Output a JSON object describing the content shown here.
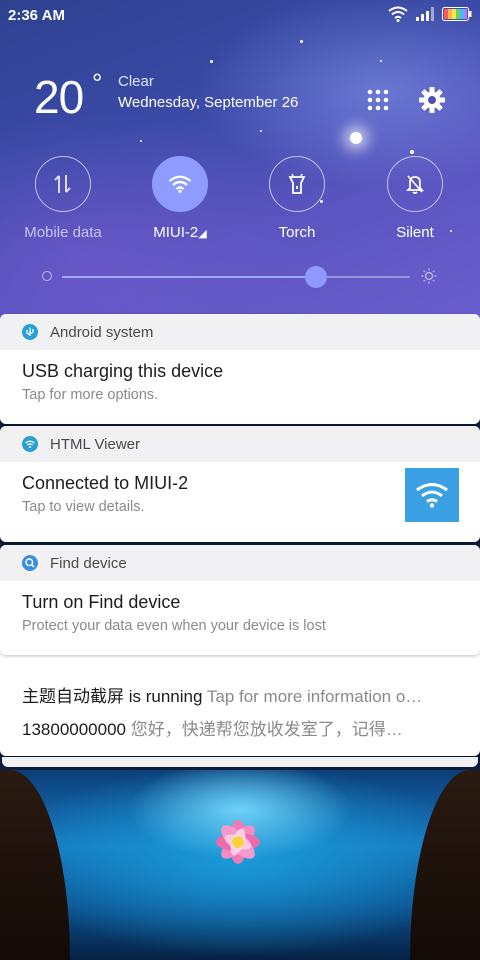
{
  "status_bar": {
    "time": "2:36 AM"
  },
  "header": {
    "temperature": "20",
    "degree": "°",
    "weather": "Clear",
    "date": "Wednesday, September 26"
  },
  "toggles": [
    {
      "label": "Mobile data",
      "state": "off"
    },
    {
      "label": "MIUI-2",
      "state": "on"
    },
    {
      "label": "Torch",
      "state": "off"
    },
    {
      "label": "Silent",
      "state": "off"
    }
  ],
  "brightness": {
    "level": 0.73
  },
  "notifications": [
    {
      "app": "Android system",
      "title": "USB charging this device",
      "text": "Tap for more options."
    },
    {
      "app": "HTML Viewer",
      "title": "Connected to MIUI-2",
      "text": "Tap to view details."
    },
    {
      "app": "Find device",
      "title": "Turn on Find device",
      "text": "Protect your data even when your device is lost"
    }
  ],
  "stacked_notification": {
    "line1_bold": "主题自动截屏 is running",
    "line1_rest": "Tap for more information o…",
    "line2_bold": "13800000000",
    "line2_rest": "您好，快递帮您放收发室了，记得…"
  },
  "colors": {
    "accent": "#8e9cff",
    "wifi_tile": "#3b9fe3"
  },
  "icons": [
    "wifi-icon",
    "signal-icon",
    "battery-icon",
    "grid-icon",
    "gear-icon",
    "data-icon",
    "torch-icon",
    "silent-icon",
    "sun-icon"
  ]
}
